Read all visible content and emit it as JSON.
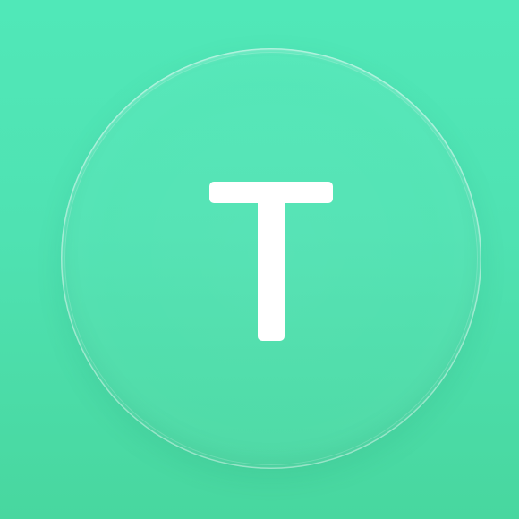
{
  "avatar": {
    "initial": "T",
    "background_color": "#4fe2b2",
    "glyph_color": "#ffffff",
    "icon": "letter-avatar-icon"
  }
}
